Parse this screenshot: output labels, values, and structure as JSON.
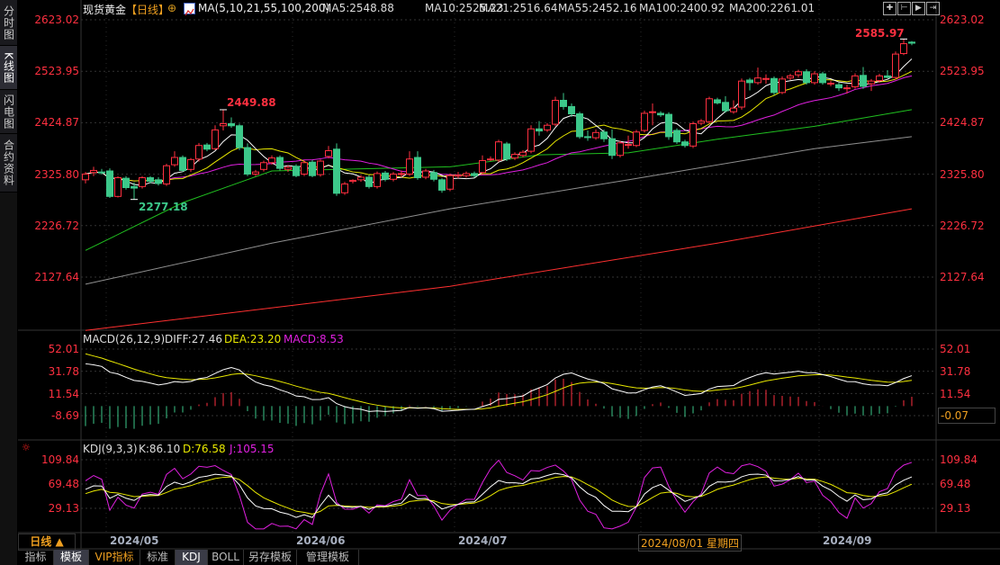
{
  "sidebar": {
    "items": [
      {
        "label": "分时图",
        "active": false
      },
      {
        "label": "K线图",
        "active": true
      },
      {
        "label": "闪电图",
        "active": false
      },
      {
        "label": "合约资料",
        "active": false
      }
    ]
  },
  "header": {
    "instrument": "现货黄金",
    "period": "【日线】",
    "ma_params": "MA(5,10,21,55,100,200)",
    "ma_values": [
      {
        "label": "MA5:2548.88",
        "color": "#ffffff"
      },
      {
        "label": "MA10:2525.23",
        "color": "#e8e800"
      },
      {
        "label": "MA21:2516.64",
        "color": "#e020e0"
      },
      {
        "label": "MA55:2452.16",
        "color": "#20c020"
      },
      {
        "label": "MA100:2400.92",
        "color": "#909090"
      },
      {
        "label": "MA200:2261.01",
        "color": "#ff3030"
      }
    ],
    "toolbar_icons": [
      "crosshair-icon",
      "zoom-in-range-icon",
      "play-forward-icon",
      "move-right-icon"
    ]
  },
  "chart_data": [
    {
      "type": "candlestick",
      "name_panel": "price",
      "ylim": [
        2080,
        2640
      ],
      "y_ticks": [
        "2623.02",
        "2523.95",
        "2424.87",
        "2325.80",
        "2226.72",
        "2127.64"
      ],
      "up_color": "#ff3040",
      "down_color": "#3cc88a",
      "annotations": [
        {
          "index": 17,
          "label": "2449.88",
          "color": "#ff3040",
          "position": "above"
        },
        {
          "index": 6,
          "label": "2277.18",
          "color": "#3cc88a",
          "position": "below"
        },
        {
          "index": 101,
          "label": "2585.97",
          "color": "#ff3040",
          "position": "above"
        }
      ],
      "candles_ohlc": [
        [
          2315,
          2330,
          2308,
          2326
        ],
        [
          2329,
          2340,
          2322,
          2333
        ],
        [
          2330,
          2336,
          2325,
          2329
        ],
        [
          2332,
          2337,
          2280,
          2283
        ],
        [
          2283,
          2322,
          2281,
          2319
        ],
        [
          2318,
          2322,
          2296,
          2300
        ],
        [
          2302,
          2310,
          2277.18,
          2299
        ],
        [
          2302,
          2322,
          2298,
          2319
        ],
        [
          2319,
          2322,
          2308,
          2312
        ],
        [
          2315,
          2320,
          2304,
          2308
        ],
        [
          2307,
          2346,
          2303,
          2342
        ],
        [
          2344,
          2370,
          2340,
          2358
        ],
        [
          2358,
          2362,
          2330,
          2333
        ],
        [
          2335,
          2357,
          2330,
          2354
        ],
        [
          2355,
          2386,
          2350,
          2381
        ],
        [
          2382,
          2386,
          2370,
          2374
        ],
        [
          2375,
          2420,
          2372,
          2411
        ],
        [
          2419,
          2449.88,
          2410,
          2423
        ],
        [
          2423,
          2435,
          2415,
          2419
        ],
        [
          2419,
          2423,
          2372,
          2377
        ],
        [
          2377,
          2385,
          2322,
          2326
        ],
        [
          2326,
          2334,
          2322,
          2330
        ],
        [
          2335,
          2352,
          2331,
          2348
        ],
        [
          2348,
          2362,
          2344,
          2357
        ],
        [
          2358,
          2362,
          2333,
          2337
        ],
        [
          2335,
          2343,
          2330,
          2339
        ],
        [
          2341,
          2345,
          2320,
          2323
        ],
        [
          2326,
          2352,
          2322,
          2348
        ],
        [
          2349,
          2353,
          2320,
          2323
        ],
        [
          2325,
          2354,
          2321,
          2351
        ],
        [
          2360,
          2380,
          2356,
          2371
        ],
        [
          2374,
          2385,
          2284,
          2289
        ],
        [
          2290,
          2311,
          2286,
          2307
        ],
        [
          2312,
          2316,
          2308,
          2314
        ],
        [
          2315,
          2324,
          2311,
          2320
        ],
        [
          2320,
          2324,
          2298,
          2302
        ],
        [
          2302,
          2331,
          2298,
          2327
        ],
        [
          2328,
          2332,
          2312,
          2316
        ],
        [
          2316,
          2330,
          2312,
          2326
        ],
        [
          2326,
          2333,
          2320,
          2327
        ],
        [
          2326,
          2370,
          2322,
          2355
        ],
        [
          2358,
          2370,
          2315,
          2319
        ],
        [
          2320,
          2336,
          2316,
          2332
        ],
        [
          2329,
          2334,
          2312,
          2316
        ],
        [
          2315,
          2318,
          2290,
          2295
        ],
        [
          2297,
          2327,
          2293,
          2323
        ],
        [
          2323,
          2330,
          2318,
          2324
        ],
        [
          2323,
          2331,
          2319,
          2327
        ],
        [
          2327,
          2331,
          2319,
          2323
        ],
        [
          2329,
          2362,
          2325,
          2352
        ],
        [
          2355,
          2360,
          2351,
          2355
        ],
        [
          2353,
          2392,
          2349,
          2388
        ],
        [
          2384,
          2388,
          2351,
          2355
        ],
        [
          2357,
          2368,
          2353,
          2364
        ],
        [
          2362,
          2372,
          2358,
          2368
        ],
        [
          2370,
          2420,
          2366,
          2413
        ],
        [
          2413,
          2428,
          2400,
          2409
        ],
        [
          2411,
          2424,
          2407,
          2420
        ],
        [
          2422,
          2475,
          2418,
          2468
        ],
        [
          2468,
          2482,
          2450,
          2456
        ],
        [
          2456,
          2462,
          2436,
          2442
        ],
        [
          2442,
          2446,
          2394,
          2398
        ],
        [
          2398,
          2410,
          2390,
          2397
        ],
        [
          2396,
          2412,
          2392,
          2406
        ],
        [
          2407,
          2412,
          2388,
          2394
        ],
        [
          2394,
          2412,
          2355,
          2362
        ],
        [
          2362,
          2390,
          2358,
          2386
        ],
        [
          2383,
          2400,
          2375,
          2383
        ],
        [
          2381,
          2411,
          2378,
          2407
        ],
        [
          2410,
          2448,
          2406,
          2443
        ],
        [
          2446,
          2462,
          2420,
          2446
        ],
        [
          2443,
          2447,
          2436,
          2440
        ],
        [
          2441,
          2445,
          2392,
          2398
        ],
        [
          2410,
          2414,
          2384,
          2388
        ],
        [
          2388,
          2392,
          2377,
          2381
        ],
        [
          2380,
          2427,
          2376,
          2423
        ],
        [
          2424,
          2432,
          2420,
          2428
        ],
        [
          2427,
          2475,
          2423,
          2471
        ],
        [
          2469,
          2473,
          2460,
          2463
        ],
        [
          2464,
          2476,
          2444,
          2448
        ],
        [
          2446,
          2468,
          2442,
          2453
        ],
        [
          2455,
          2510,
          2450,
          2505
        ],
        [
          2507,
          2511,
          2487,
          2502
        ],
        [
          2502,
          2531,
          2498,
          2511
        ],
        [
          2510,
          2518,
          2500,
          2510
        ],
        [
          2510,
          2514,
          2478,
          2483
        ],
        [
          2483,
          2514,
          2480,
          2509
        ],
        [
          2511,
          2519,
          2507,
          2515
        ],
        [
          2517,
          2527,
          2512,
          2523
        ],
        [
          2523,
          2528,
          2498,
          2502
        ],
        [
          2502,
          2524,
          2498,
          2519
        ],
        [
          2519,
          2523,
          2498,
          2502
        ],
        [
          2500,
          2506,
          2495,
          2501
        ],
        [
          2498,
          2502,
          2486,
          2492
        ],
        [
          2492,
          2498,
          2481,
          2492
        ],
        [
          2494,
          2520,
          2490,
          2515
        ],
        [
          2516,
          2532,
          2490,
          2495
        ],
        [
          2500,
          2509,
          2486,
          2505
        ],
        [
          2506,
          2519,
          2502,
          2515
        ],
        [
          2515,
          2526,
          2510,
          2512
        ],
        [
          2512,
          2562,
          2508,
          2557
        ],
        [
          2558,
          2585.97,
          2555,
          2577
        ],
        [
          2580,
          2582,
          2574,
          2578
        ]
      ],
      "long_ma_anchors": {
        "MA55": [
          [
            0,
            2179
          ],
          [
            12,
            2271
          ],
          [
            23,
            2332
          ],
          [
            45,
            2340
          ],
          [
            56,
            2363
          ],
          [
            67,
            2367
          ],
          [
            78,
            2393
          ],
          [
            90,
            2418
          ],
          [
            102,
            2450
          ]
        ],
        "MA100": [
          [
            0,
            2114
          ],
          [
            23,
            2193
          ],
          [
            45,
            2259
          ],
          [
            67,
            2315
          ],
          [
            90,
            2375
          ],
          [
            102,
            2398
          ]
        ],
        "MA200": [
          [
            0,
            2025
          ],
          [
            45,
            2110
          ],
          [
            78,
            2193
          ],
          [
            102,
            2259
          ]
        ]
      }
    },
    {
      "type": "line+bar",
      "name_panel": "MACD",
      "legend": [
        {
          "label": "MACD(26,12,9)",
          "color": "#dddddd"
        },
        {
          "label": "DIFF:27.46",
          "color": "#dddddd"
        },
        {
          "label": "DEA:23.20",
          "color": "#e8e800"
        },
        {
          "label": "MACD:8.53",
          "color": "#e020e0"
        }
      ],
      "ylim": [
        -20,
        62
      ],
      "y_ticks_left": [
        "52.01",
        "31.78",
        "11.54",
        "-8.69"
      ],
      "y_ticks_right": [
        "52.01",
        "31.78",
        "11.54"
      ],
      "current_value": "-0.07"
    },
    {
      "type": "line",
      "name_panel": "KDJ",
      "legend": [
        {
          "label": "KDJ(9,3,3)",
          "color": "#dddddd"
        },
        {
          "label": "K:86.10",
          "color": "#dddddd"
        },
        {
          "label": "D:76.58",
          "color": "#e8e800"
        },
        {
          "label": "J:105.15",
          "color": "#e020e0"
        }
      ],
      "y_ticks": [
        "109.84",
        "69.48",
        "29.13"
      ]
    }
  ],
  "xaxis": {
    "period_button": "日线 ▲",
    "labels": [
      {
        "index": 3,
        "label": "2024/05"
      },
      {
        "index": 26,
        "label": "2024/06"
      },
      {
        "index": 46,
        "label": "2024/07"
      },
      {
        "index": 69,
        "label": "2024/08/01 星期四",
        "highlight": true
      },
      {
        "index": 91,
        "label": "2024/09"
      }
    ]
  },
  "bottom_tabs": [
    {
      "label": "指标"
    },
    {
      "label": "模板",
      "active": true
    },
    {
      "label": "VIP指标",
      "vip": true
    },
    {
      "label": "标准"
    },
    {
      "label": "KDJ",
      "active": true
    },
    {
      "label": "BOLL"
    },
    {
      "label": "另存模板"
    },
    {
      "label": "管理模板"
    }
  ]
}
